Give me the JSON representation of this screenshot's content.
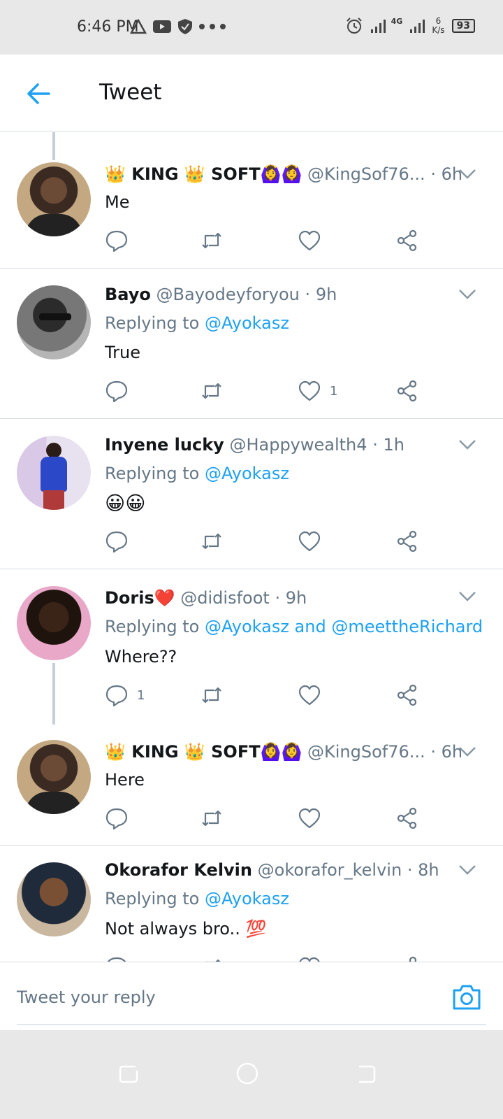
{
  "status_bar": {
    "time": "6:46 PM",
    "network": "4G",
    "speed": "6",
    "speed_unit": "K/s",
    "battery": "93"
  },
  "header": {
    "title": "Tweet"
  },
  "tweets": [
    {
      "name": "👑 KING 👑 SOFT🙆‍♀️🙆‍♀️",
      "handle": "@KingSof76...",
      "time": "6h",
      "body": "Me",
      "comments": "",
      "likes": ""
    },
    {
      "name": "Bayo",
      "handle": "@Bayodeyforyou",
      "time": "9h",
      "reply_prefix": "Replying to",
      "reply_to": "@Ayokasz",
      "body": "True",
      "comments": "",
      "likes": "1"
    },
    {
      "name": "Inyene lucky",
      "handle": "@Happywealth4",
      "time": "1h",
      "reply_prefix": "Replying to",
      "reply_to": "@Ayokasz",
      "body": "😀😀",
      "comments": "",
      "likes": ""
    },
    {
      "name": "Doris❤️",
      "handle": "@didisfoot",
      "time": "9h",
      "reply_prefix": "Replying to",
      "reply_to": "@Ayokasz and @meettheRichard",
      "body": "Where??",
      "comments": "1",
      "likes": ""
    },
    {
      "name": "👑 KING 👑 SOFT🙆‍♀️🙆‍♀️",
      "handle": "@KingSof76...",
      "time": "6h",
      "body": "Here",
      "comments": "",
      "likes": ""
    },
    {
      "name": "Okorafor Kelvin",
      "handle": "@okorafor_kelvin",
      "time": "8h",
      "reply_prefix": "Replying to",
      "reply_to": "@Ayokasz",
      "body": "Not always bro.. 💯",
      "comments": "",
      "likes": ""
    }
  ],
  "reply_bar": {
    "placeholder": "Tweet your reply"
  },
  "colors": {
    "accent": "#1da1f2",
    "secondary_text": "#657786",
    "divider": "#d6dde3"
  }
}
